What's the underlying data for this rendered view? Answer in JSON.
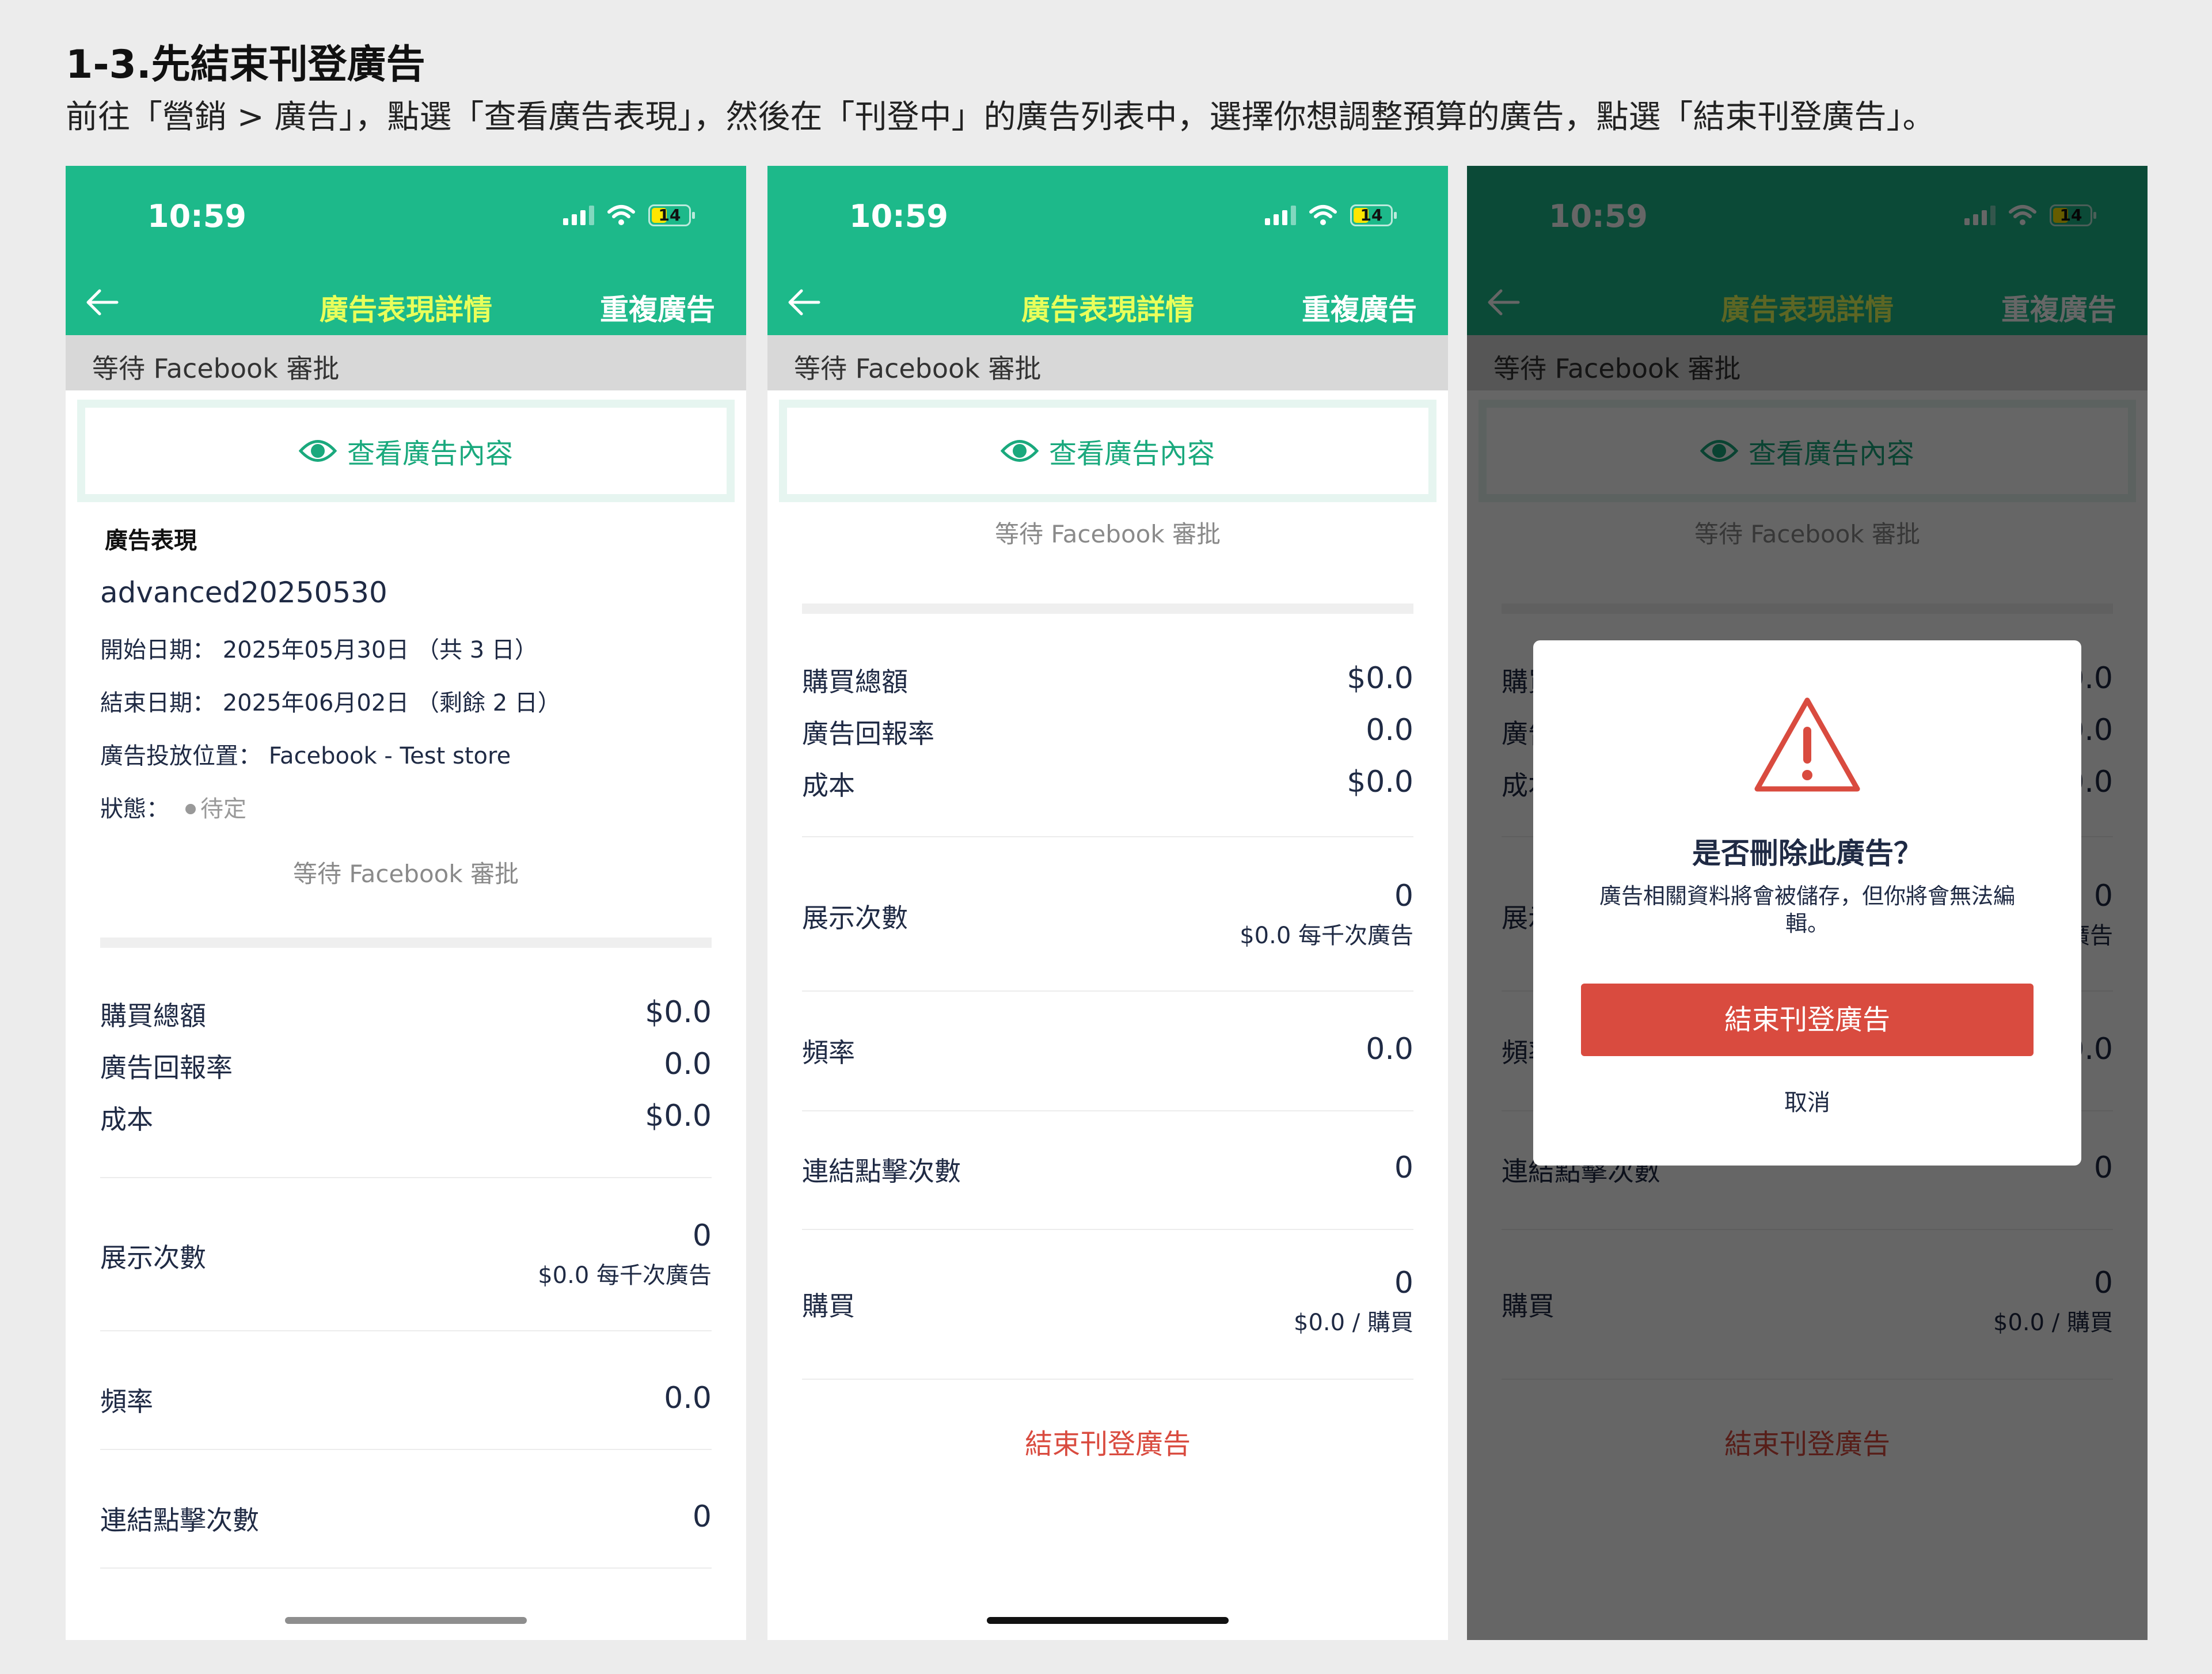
{
  "heading": {
    "title": "1-3.先結束刊登廣告",
    "description": "前往「營銷 > 廣告」，點選「查看廣告表現」，然後在「刊登中」的廣告列表中，選擇你想調整預算的廣告，點選「結束刊登廣告」。"
  },
  "status_bar": {
    "time": "10:59",
    "battery": "14"
  },
  "nav": {
    "title": "廣告表現詳情",
    "duplicate": "重複廣告"
  },
  "pending_banner": "等待 Facebook 審批",
  "view_ad_button": "查看廣告內容",
  "performance": {
    "section_title": "廣告表現",
    "ad_name": "advanced20250530",
    "start_label": "開始日期：",
    "start_value": "2025年05月30日 （共 3 日）",
    "end_label": "結束日期：",
    "end_value": "2025年06月02日 （剩餘 2 日）",
    "placement_label": "廣告投放位置：",
    "placement_value": "Facebook - Test store",
    "status_label": "狀態：",
    "status_value": "待定",
    "pending_note": "等待 Facebook 審批"
  },
  "metrics": {
    "purchase_total_label": "購買總額",
    "purchase_total": "$0.0",
    "roas_label": "廣告回報率",
    "roas": "0.0",
    "cost_label": "成本",
    "cost": "$0.0",
    "impressions_label": "展示次數",
    "impressions": "0",
    "cpm": "$0.0 每千次廣告",
    "frequency_label": "頻率",
    "frequency": "0.0",
    "link_clicks_label": "連結點擊次數",
    "link_clicks": "0",
    "purchases_label": "購買",
    "purchases": "0",
    "cost_per_purchase": "$0.0 / 購買"
  },
  "end_ad_link": "結束刊登廣告",
  "dialog": {
    "title": "是否刪除此廣告？",
    "message": "廣告相關資料將會被儲存，但你將會無法編輯。",
    "confirm": "結束刊登廣告",
    "cancel": "取消"
  },
  "colors": {
    "brand": "#1db98a",
    "nav_title": "#e9ff5a",
    "danger": "#d94b3f",
    "link_green": "#1aa97d"
  }
}
